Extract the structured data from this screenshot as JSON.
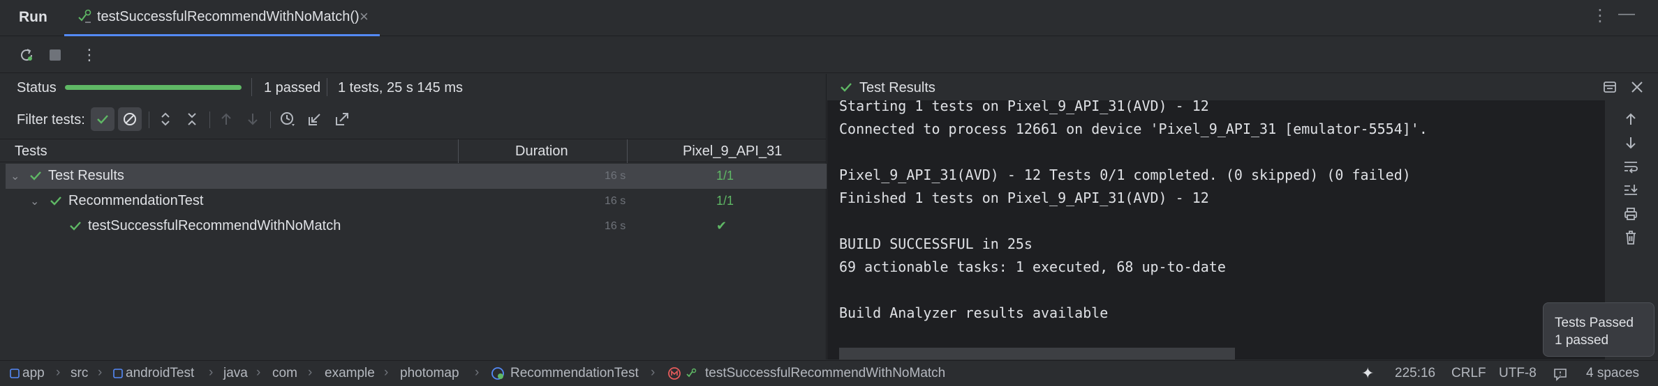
{
  "topbar": {
    "run_label": "Run",
    "tab_label": "testSuccessfulRecommendWithNoMatch()",
    "close_glyph": "×",
    "more_glyph": "⋮",
    "minimize_glyph": "—"
  },
  "status": {
    "label": "Status",
    "progress": 1.0,
    "passed": "1 passed",
    "summary": "1 tests, 25 s 145 ms"
  },
  "filter": {
    "label": "Filter tests:"
  },
  "grid": {
    "columns": [
      "Tests",
      "Duration",
      "Pixel_9_API_31"
    ],
    "rows": [
      {
        "name": "Test Results",
        "duration": "16 s",
        "result": "1/1",
        "level": 0
      },
      {
        "name": "RecommendationTest",
        "duration": "16 s",
        "result": "1/1",
        "level": 1
      },
      {
        "name": "testSuccessfulRecommendWithNoMatch",
        "duration": "16 s",
        "result": "✔",
        "level": 2
      }
    ]
  },
  "console": {
    "title": "Test Results",
    "lines": [
      "Starting 1 tests on Pixel_9_API_31(AVD) - 12",
      "Connected to process 12661 on device 'Pixel_9_API_31 [emulator-5554]'.",
      "",
      "Pixel_9_API_31(AVD) - 12 Tests 0/1 completed. (0 skipped) (0 failed)",
      "Finished 1 tests on Pixel_9_API_31(AVD) - 12",
      "",
      "BUILD SUCCESSFUL in 25s",
      "69 actionable tasks: 1 executed, 68 up-to-date",
      "",
      "Build Analyzer results available"
    ]
  },
  "toast": {
    "title": "Tests Passed",
    "body": "1 passed"
  },
  "breadcrumb": [
    "app",
    "src",
    "androidTest",
    "java",
    "com",
    "example",
    "photomap",
    "RecommendationTest",
    "testSuccessfulRecommendWithNoMatch"
  ],
  "statusbar": {
    "position": "225:16",
    "line_ending": "CRLF",
    "encoding": "UTF-8",
    "indent": "4 spaces"
  },
  "colors": {
    "accent": "#548af7",
    "success": "#5fb865",
    "background": "#2b2d30",
    "console_bg": "#1e1f22"
  }
}
